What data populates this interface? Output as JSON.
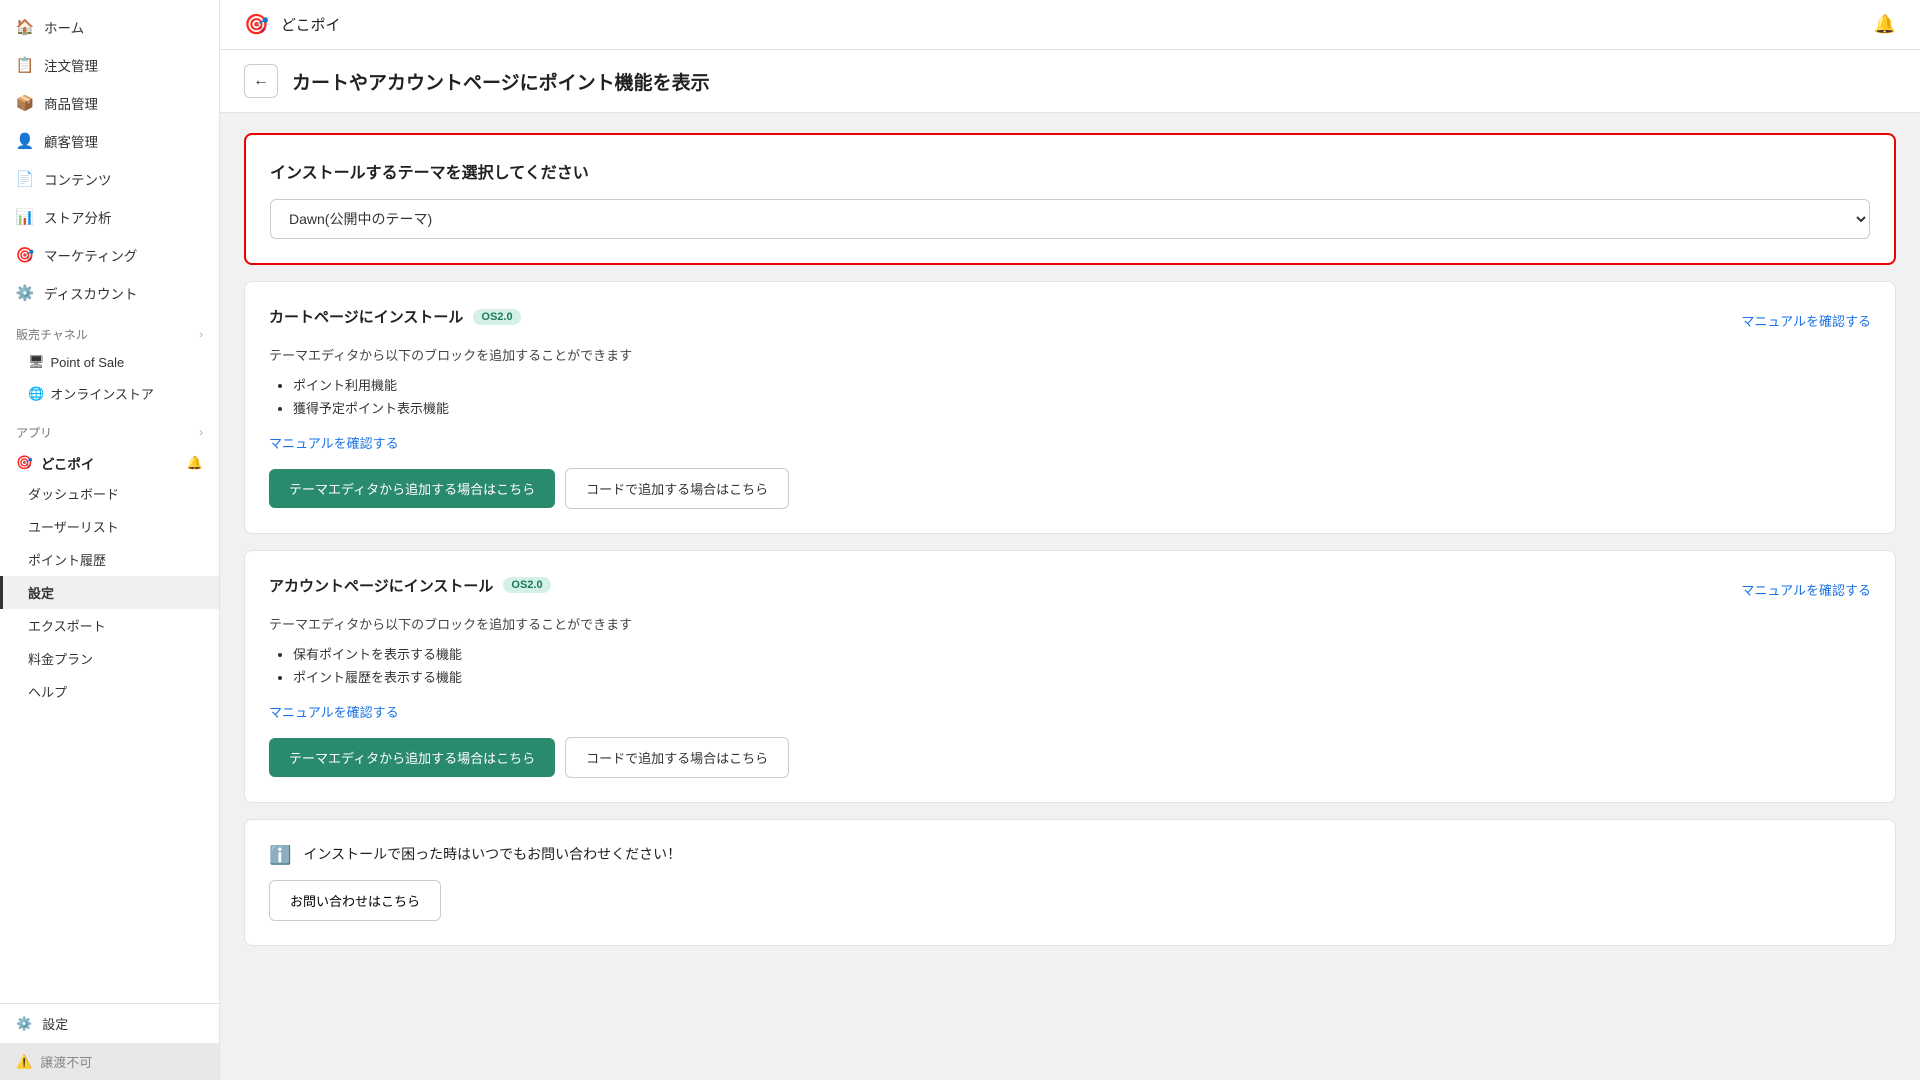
{
  "sidebar": {
    "nav_items": [
      {
        "id": "home",
        "label": "ホーム",
        "icon": "🏠"
      },
      {
        "id": "orders",
        "label": "注文管理",
        "icon": "📋"
      },
      {
        "id": "products",
        "label": "商品管理",
        "icon": "📦"
      },
      {
        "id": "customers",
        "label": "顧客管理",
        "icon": "👤"
      },
      {
        "id": "content",
        "label": "コンテンツ",
        "icon": "📄"
      },
      {
        "id": "analytics",
        "label": "ストア分析",
        "icon": "📊"
      },
      {
        "id": "marketing",
        "label": "マーケティング",
        "icon": "🎯"
      },
      {
        "id": "discounts",
        "label": "ディスカウント",
        "icon": "⚙️"
      }
    ],
    "sales_channel_label": "販売チャネル",
    "sales_channels": [
      {
        "id": "pos",
        "label": "Point of Sale",
        "icon": "🖥"
      },
      {
        "id": "online",
        "label": "オンラインストア",
        "icon": "🌐"
      }
    ],
    "apps_label": "アプリ",
    "app_name": "どこポイ",
    "app_sub_items": [
      {
        "id": "dashboard",
        "label": "ダッシュボード"
      },
      {
        "id": "user-list",
        "label": "ユーザーリスト"
      },
      {
        "id": "point-history",
        "label": "ポイント履歴"
      },
      {
        "id": "settings",
        "label": "設定",
        "active": true
      },
      {
        "id": "export",
        "label": "エクスポート"
      },
      {
        "id": "pricing",
        "label": "料金プラン"
      },
      {
        "id": "help",
        "label": "ヘルプ"
      }
    ],
    "bottom_items": [
      {
        "id": "settings",
        "label": "設定",
        "icon": "⚙️"
      }
    ],
    "unavailable_label": "譲渡不可"
  },
  "topbar": {
    "app_icon": "🎯",
    "app_name": "どこポイ"
  },
  "page": {
    "title": "カートやアカウントページにポイント機能を表示",
    "back_button_label": "←"
  },
  "theme_selector": {
    "label": "インストールするテーマを選択してください",
    "current_value": "Dawn(公開中のテーマ)",
    "options": [
      "Dawn(公開中のテーマ)"
    ]
  },
  "cart_section": {
    "title": "カートページにインストール",
    "badge": "OS2.0",
    "manual_link": "マニュアルを確認する",
    "description": "テーマエディタから以下のブロックを追加することができます",
    "features": [
      "ポイント利用機能",
      "獲得予定ポイント表示機能"
    ],
    "manual_link2": "マニュアルを確認する",
    "btn_theme_editor": "テーマエディタから追加する場合はこちら",
    "btn_code": "コードで追加する場合はこちら"
  },
  "account_section": {
    "title": "アカウントページにインストール",
    "badge": "OS2.0",
    "manual_link": "マニュアルを確認する",
    "description": "テーマエディタから以下のブロックを追加することができます",
    "features": [
      "保有ポイントを表示する機能",
      "ポイント履歴を表示する機能"
    ],
    "manual_link2": "マニュアルを確認する",
    "btn_theme_editor": "テーマエディタから追加する場合はこちら",
    "btn_code": "コードで追加する場合はこちら"
  },
  "support_section": {
    "info_text": "インストールで困った時はいつでもお問い合わせください！",
    "contact_btn": "お問い合わせはこちら"
  }
}
